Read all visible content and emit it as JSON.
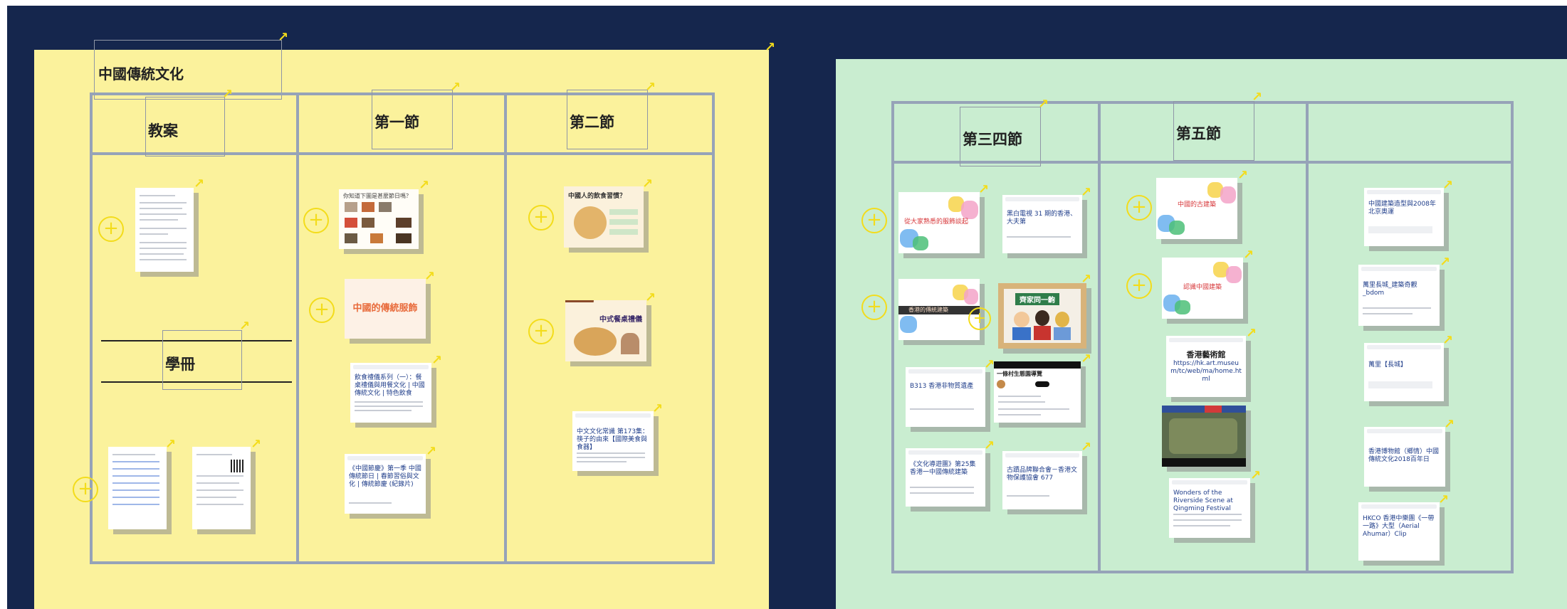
{
  "colors": {
    "canvas": "#15264d",
    "board_yellow": "#fbf29c",
    "board_green": "#c9edd0",
    "grid": "#96a3b8",
    "accent": "#f3dc1b"
  },
  "icons": {
    "add": "plus-circle-icon",
    "expand": "arrow-up-right-icon"
  },
  "yellow_board": {
    "title": "中國傳統文化",
    "col1_header": "教案",
    "col2_header": "第一節",
    "col3_header": "第二節",
    "booklet_label": "學冊",
    "slides": {
      "costume": "中國的傳統服飾",
      "dining_title": "中國人的飲食習慣？",
      "banquet": "中式餐桌禮儀",
      "intro": "你知道下圖是甚麼節日嗎？"
    },
    "links": {
      "l1": "飲食禮儀系列（一）：餐桌禮儀與用餐文化 | 中國傳統文化 | 特色飲食",
      "l2": "《中國節慶》第一季 中國傳統節日 | 春節習俗與文化 | 傳統節慶 (紀錄片)",
      "l3": "中文文化常識 第173集：筷子的由來【國際美食與食器】"
    }
  },
  "green_board": {
    "col1_header": "第三四節",
    "col2_header": "第五節",
    "slides": {
      "s1": "從大家熟悉的服飾談起",
      "s2": "香港的傳統建築",
      "s3": "中國的古建築",
      "s4": "認識中國建築",
      "poster": "齊家同一齣",
      "museum_title": "香港藝術館",
      "museum_url": "https://hk.art.museum/tc/web/ma/home.html"
    },
    "links": {
      "l1": "黑白電視 31 期的香港、大夫第",
      "l2": "B313 香港非物質遺產",
      "l3": "一條村生態園導覽",
      "l4": "《文化導遊團》第25集 香港一中國傳統建築",
      "l5": "古蹟品牌聯合會－香港文物保護協會 677",
      "l6": "Wonders of the Riverside Scene at Qingming Festival",
      "l7": "中國建築造型與2008年北京奧運",
      "l8": "萬里長城_建築奇觀_bdom",
      "l9": "萬里【長城】",
      "l10": "香港博物館（鄉情）中國傳統文化2018百年日",
      "l11": "HKCO 香港中樂團《一帶一路》大型（Aerial Ahumar）Clip"
    }
  }
}
